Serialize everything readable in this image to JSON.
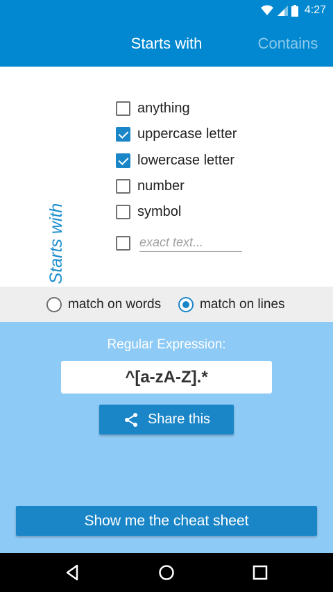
{
  "status_bar": {
    "time": "4:27"
  },
  "tabs": [
    {
      "label": "Starts with"
    },
    {
      "label": "Contains"
    }
  ],
  "section_label": "Starts with",
  "options": [
    {
      "label": "anything",
      "checked": false
    },
    {
      "label": "uppercase letter",
      "checked": true
    },
    {
      "label": "lowercase letter",
      "checked": true
    },
    {
      "label": "number",
      "checked": false
    },
    {
      "label": "symbol",
      "checked": false
    }
  ],
  "exact_text": {
    "placeholder": "exact text...",
    "value": "",
    "checked": false
  },
  "match_mode": [
    {
      "label": "match on words",
      "selected": false
    },
    {
      "label": "match on lines",
      "selected": true
    }
  ],
  "result": {
    "caption": "Regular Expression:",
    "regex": "^[a-zA-Z].*",
    "share_label": "Share this",
    "cheat_label": "Show me the cheat sheet"
  },
  "colors": {
    "primary": "#0288d1",
    "accent": "#1a86c8",
    "result_bg": "#8ecaf6",
    "match_bar_bg": "#eeeeee"
  }
}
